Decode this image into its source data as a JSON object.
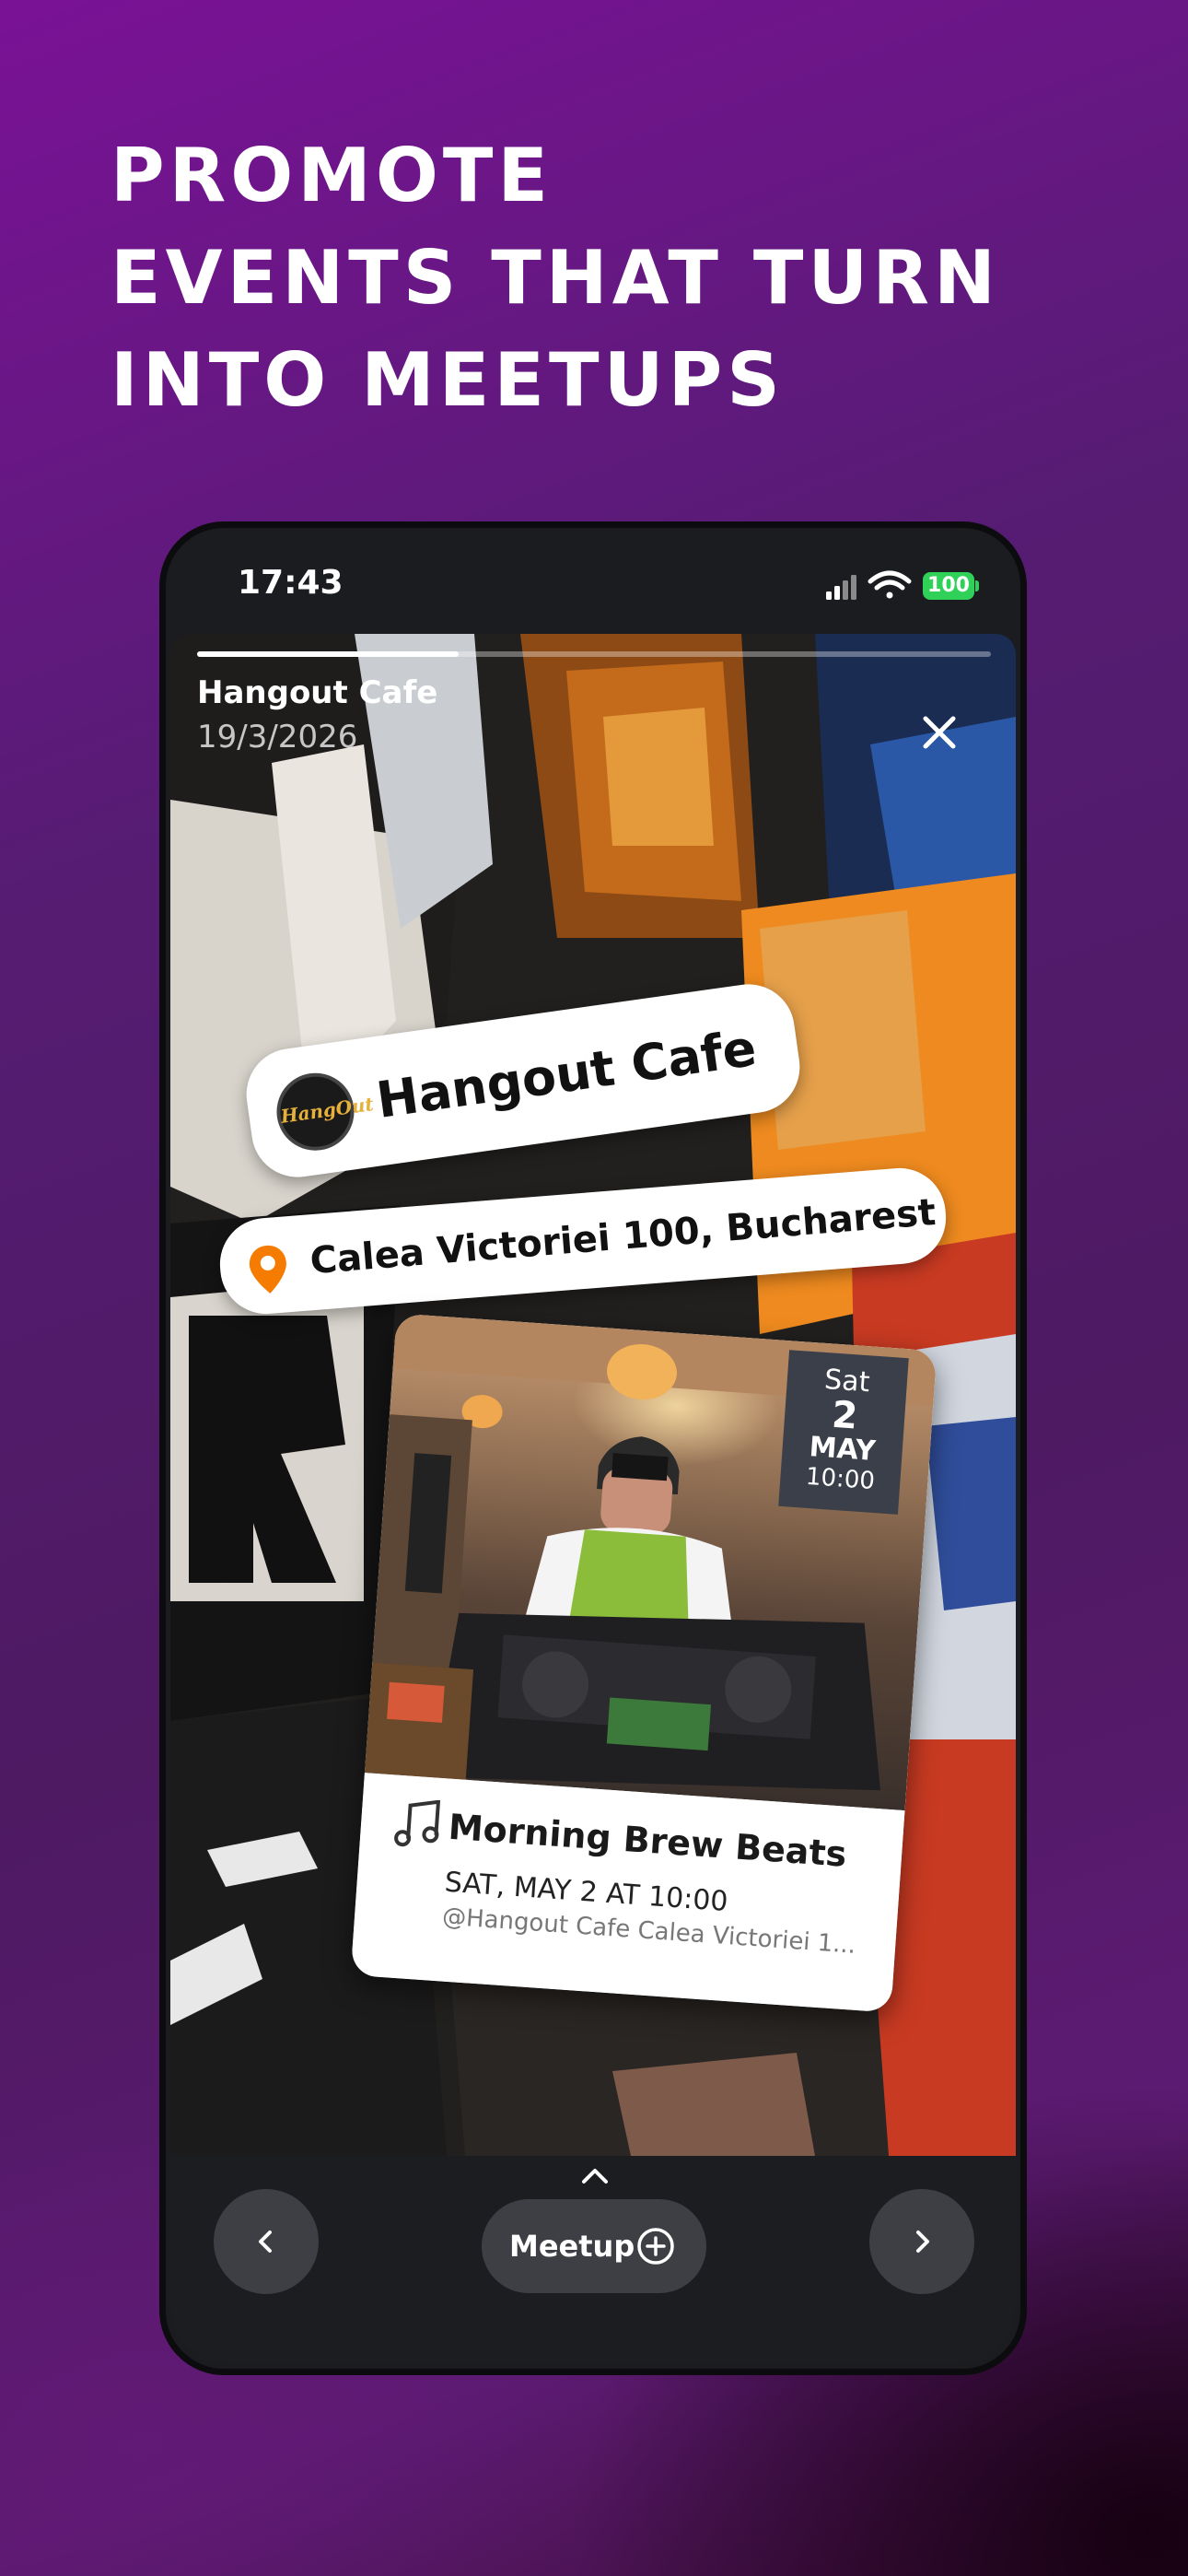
{
  "headline": {
    "lines": [
      "PROMOTE",
      "EVENTS THAT TURN",
      "INTO MEETUPS"
    ]
  },
  "status_bar": {
    "time": "17:43",
    "battery": "100",
    "icons": [
      "signal-icon",
      "wifi-icon",
      "battery-icon"
    ]
  },
  "story": {
    "progress": 0.33,
    "venue": "Hangout Cafe",
    "date": "19/3/2026",
    "close_icon": "close-icon"
  },
  "sticker_venue": {
    "logo_text": "HangOut",
    "name": "Hangout Cafe"
  },
  "sticker_address": {
    "icon": "location-pin-icon",
    "address": "Calea Victoriei 100, Bucharest"
  },
  "event_card": {
    "badge": {
      "day": "Sat",
      "date": "2",
      "month": "MAY",
      "time": "10:00"
    },
    "icon": "music-note-icon",
    "title": "Morning Brew Beats",
    "datetime": "SAT, MAY 2 AT 10:00",
    "place": "@Hangout Cafe Calea Victoriei 1..."
  },
  "bottom_bar": {
    "expand_icon": "chevron-up-icon",
    "prev_icon": "chevron-left-icon",
    "next_icon": "chevron-right-icon",
    "meetup_label": "Meetup",
    "meetup_icon": "plus-circle-icon"
  },
  "colors": {
    "accent_pin": "#f57c00",
    "battery": "#2fd158",
    "background": "#561c73"
  }
}
